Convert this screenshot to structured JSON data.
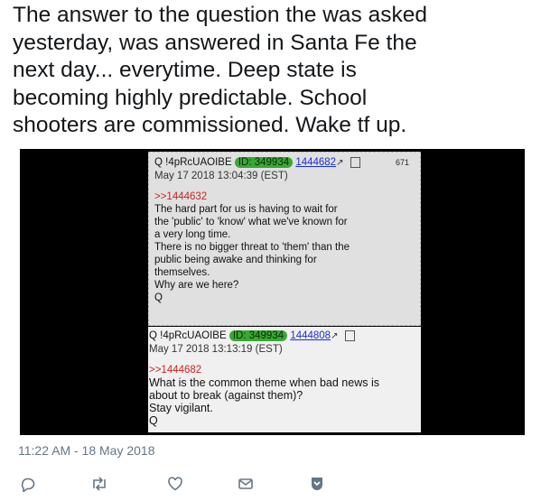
{
  "tweet": {
    "lines": [
      "The answer to the question the was asked",
      "yesterday,  was answered in Santa Fe the",
      "next day... everytime.  Deep state is",
      "becoming highly predictable. School",
      "shooters are commissioned.  Wake tf up."
    ],
    "timestamp": "11:22 AM - 18 May 2018"
  },
  "post1": {
    "name": "Q !4pRcUAOIBE",
    "id": "ID: 349934",
    "postnum": "1444682",
    "count": "671",
    "date": "May 17 2018 13:04:39 (EST)",
    "quote": ">>1444632",
    "body": [
      "The hard part for us is having to wait for",
      "the 'public' to 'know' what we've known for",
      "a very long time.",
      "There is no bigger threat to 'them' than the",
      "public being awake and thinking for",
      "themselves.",
      "Why are we here?",
      "Q"
    ]
  },
  "post2": {
    "name": "Q !4pRcUAOIBE",
    "id": "ID: 349934",
    "postnum": "1444808",
    "date": "May 17 2018 13:13:19 (EST)",
    "quote": ">>1444682",
    "body": [
      "What is the common theme when bad news is",
      "about to break (against them)?",
      "Stay vigilant.",
      "Q"
    ]
  },
  "actions": {
    "icons": [
      "reply-icon",
      "retweet-icon",
      "like-icon",
      "message-icon",
      "bookmark-icon"
    ],
    "accent_color": "#1da1f2",
    "icon_color": "#657786"
  }
}
